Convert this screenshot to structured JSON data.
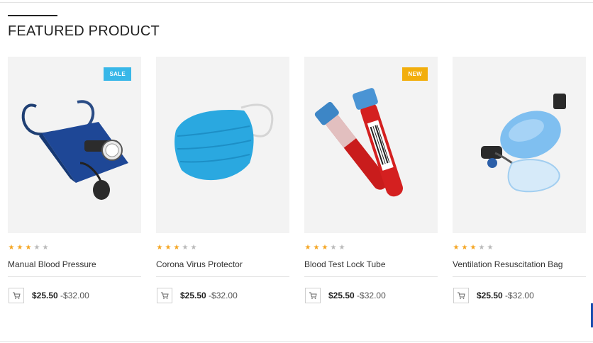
{
  "section": {
    "title": "FEATURED PRODUCT"
  },
  "products": [
    {
      "name": "Manual Blood Pressure",
      "badge": "SALE",
      "badge_type": "sale",
      "rating": 3,
      "max_rating": 5,
      "price_low": "$25.50",
      "price_high": "-$32.00",
      "image_icon": "blood-pressure-cuff"
    },
    {
      "name": "Corona Virus Protector",
      "badge": "",
      "badge_type": "",
      "rating": 3,
      "max_rating": 5,
      "price_low": "$25.50",
      "price_high": "-$32.00",
      "image_icon": "face-mask"
    },
    {
      "name": "Blood Test Lock Tube",
      "badge": "NEW",
      "badge_type": "new",
      "rating": 3,
      "max_rating": 5,
      "price_low": "$25.50",
      "price_high": "-$32.00",
      "image_icon": "blood-test-tubes"
    },
    {
      "name": "Ventilation Resuscitation Bag",
      "badge": "",
      "badge_type": "",
      "rating": 3,
      "max_rating": 5,
      "price_low": "$25.50",
      "price_high": "-$32.00",
      "image_icon": "resuscitation-bag"
    }
  ],
  "colors": {
    "accent_star": "#f5a623",
    "sale_badge": "#38b7e8",
    "new_badge": "#f2ae0c",
    "side_tab": "#1c4fb0"
  }
}
